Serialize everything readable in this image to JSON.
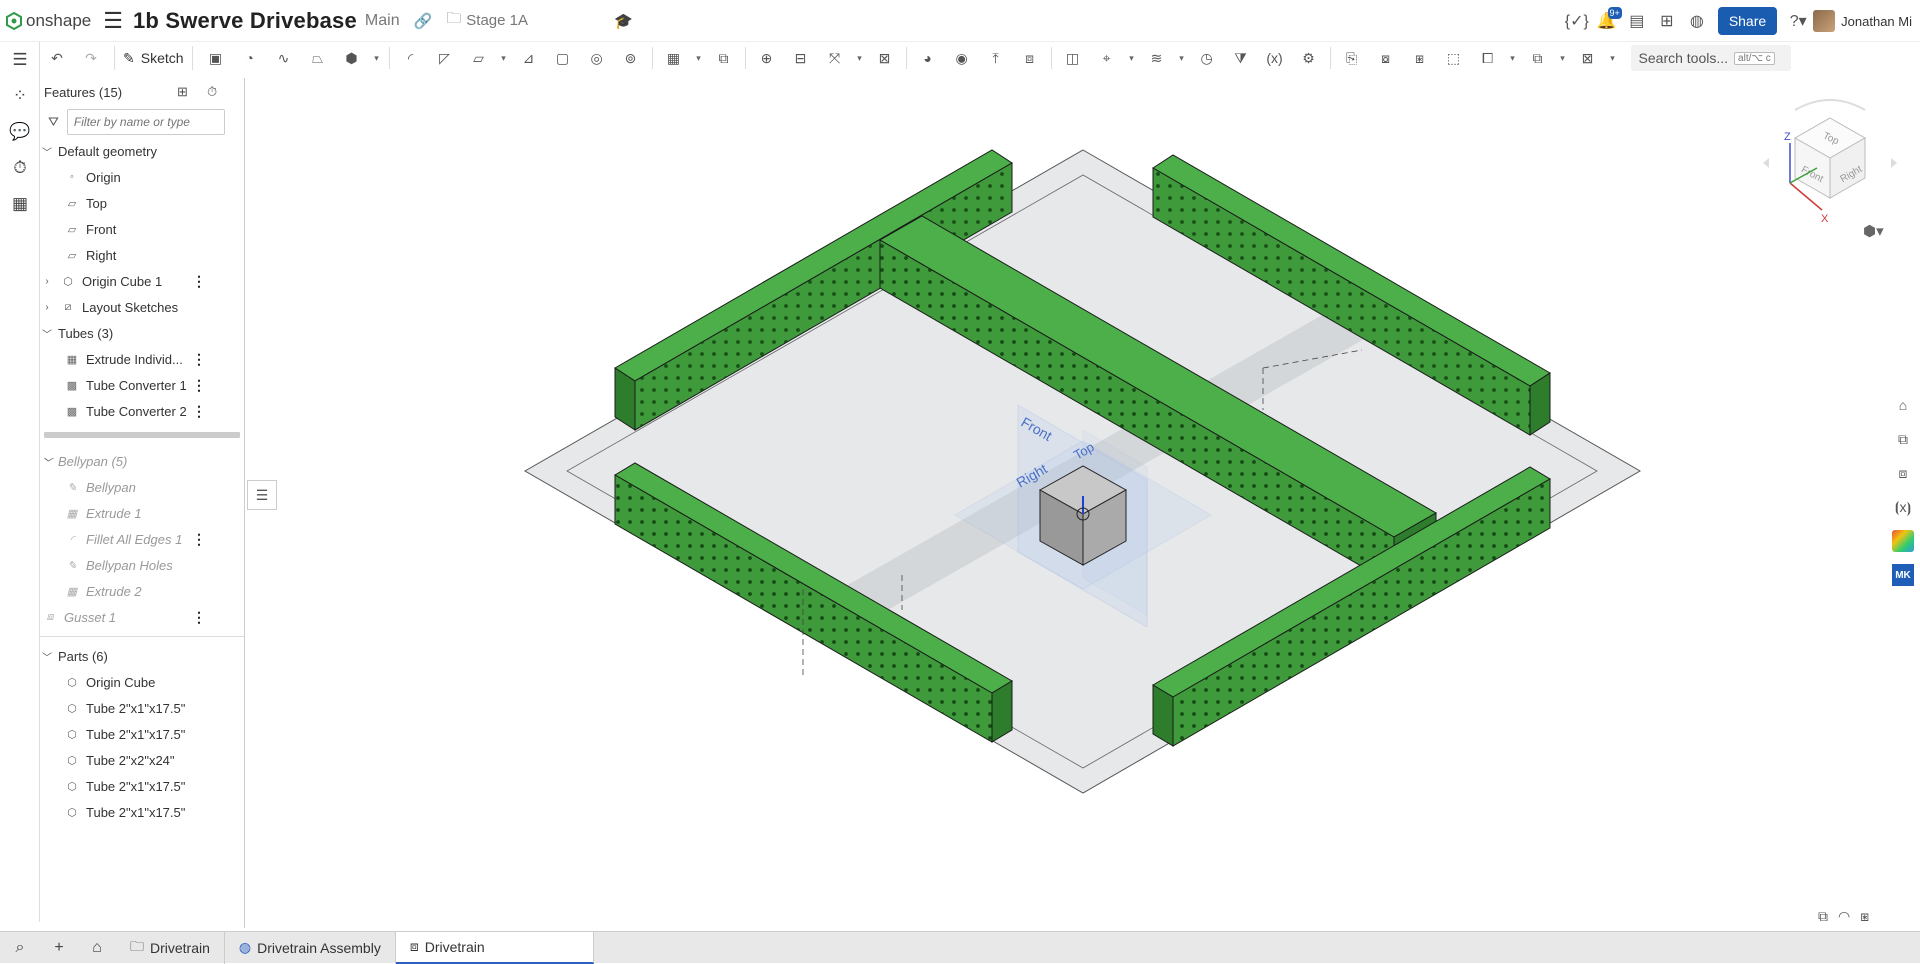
{
  "header": {
    "app_name": "onshape",
    "document_title": "1b Swerve Drivebase",
    "branch": "Main",
    "folder": "Stage 1A",
    "notification_count": "9+",
    "share_label": "Share",
    "user_name": "Jonathan Mi"
  },
  "toolbar": {
    "sketch_label": "Sketch",
    "search_placeholder": "Search tools...",
    "search_shortcut": "alt/⌥  c"
  },
  "panel": {
    "features_header": "Features (15)",
    "filter_placeholder": "Filter by name or type",
    "default_geometry": "Default geometry",
    "origin": "Origin",
    "top": "Top",
    "front": "Front",
    "right": "Right",
    "origin_cube": "Origin Cube 1",
    "layout_sketches": "Layout Sketches",
    "tubes_folder": "Tubes (3)",
    "extrude_individual": "Extrude Individ...",
    "tube_converter_1": "Tube Converter 1",
    "tube_converter_2": "Tube Converter 2",
    "bellypan_folder": "Bellypan (5)",
    "bellypan": "Bellypan",
    "extrude_1": "Extrude 1",
    "fillet_all_edges": "Fillet All Edges 1",
    "bellypan_holes": "Bellypan Holes",
    "extrude_2": "Extrude 2",
    "gusset_1": "Gusset 1",
    "parts_header": "Parts (6)",
    "parts": [
      "Origin Cube",
      "Tube 2\"x1\"x17.5\"",
      "Tube 2\"x1\"x17.5\"",
      "Tube 2\"x2\"x24\"",
      "Tube 2\"x1\"x17.5\"",
      "Tube 2\"x1\"x17.5\""
    ]
  },
  "viewcube": {
    "top": "Top",
    "front": "Front",
    "right": "Right",
    "axis_x": "X",
    "axis_z": "Z"
  },
  "viewport": {
    "plane_front": "Front",
    "plane_top": "Top",
    "plane_right": "Right"
  },
  "tabs": [
    {
      "label": "Drivetrain"
    },
    {
      "label": "Drivetrain Assembly"
    },
    {
      "label": "Drivetrain"
    }
  ],
  "colors": {
    "tube_green": "#3e9a3a",
    "tube_green_dark": "#2b7a2a",
    "accent_blue": "#1a5cb0"
  }
}
